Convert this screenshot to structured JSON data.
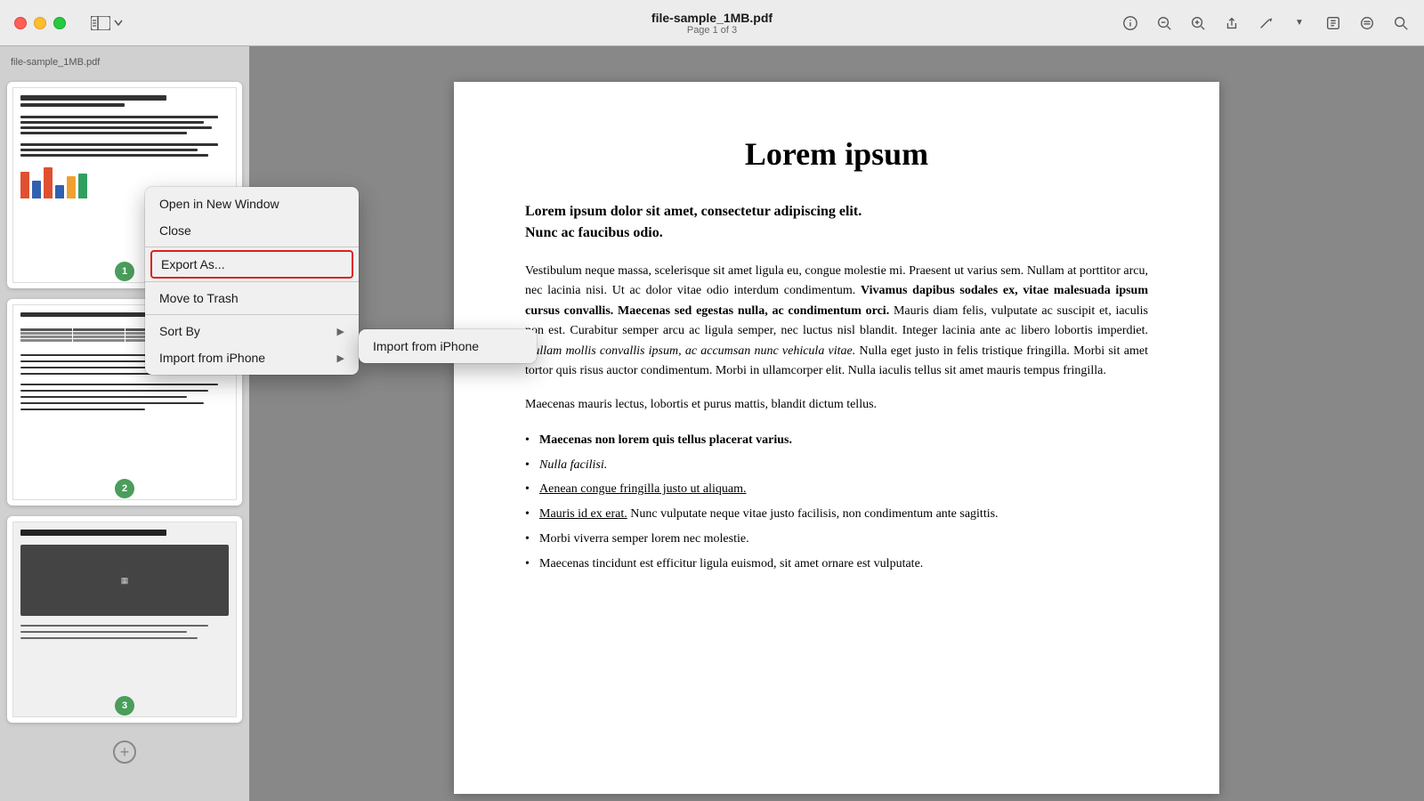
{
  "titlebar": {
    "file_name": "file-sample_1MB.pdf",
    "page_info": "Page 1 of 3"
  },
  "sidebar": {
    "label": "file-sample_1MB.pdf",
    "pages": [
      {
        "number": 1
      },
      {
        "number": 2
      },
      {
        "number": 3
      }
    ]
  },
  "context_menu": {
    "items": [
      {
        "id": "open_new_window",
        "label": "Open in New Window",
        "has_submenu": false
      },
      {
        "id": "close",
        "label": "Close",
        "has_submenu": false
      },
      {
        "id": "export_as",
        "label": "Export As...",
        "has_submenu": false,
        "highlighted": true
      },
      {
        "id": "move_to_trash",
        "label": "Move to Trash",
        "has_submenu": false
      },
      {
        "id": "sort_by",
        "label": "Sort By",
        "has_submenu": true
      },
      {
        "id": "import_from_iphone",
        "label": "Import from iPhone",
        "has_submenu": true
      }
    ]
  },
  "submenu": {
    "items": [
      {
        "id": "import_from_iphone_item",
        "label": "Import from iPhone"
      }
    ]
  },
  "pdf": {
    "title": "Lorem ipsum",
    "bold_intro": "Lorem ipsum dolor sit amet, consectetur adipiscing elit.\nNunc ac faucibus odio.",
    "body1": "Vestibulum neque massa, scelerisque sit amet ligula eu, congue molestie mi. Praesent ut varius sem. Nullam at porttitor arcu, nec lacinia nisi. Ut ac dolor vitae odio interdum condimentum. Vivamus dapibus sodales ex, vitae malesuada ipsum cursus convallis. Maecenas sed egestas nulla, ac condimentum orci. Mauris diam felis, vulputate ac suscipit et, iaculis non est. Curabitur semper arcu ac ligula semper, nec luctus nisl blandit. Integer lacinia ante ac libero lobortis imperdiet. Nullam mollis convallis ipsum, ac accumsan nunc vehicula vitae. Nulla eget justo in felis tristique fringilla. Morbi sit amet tortor quis risus auctor condimentum. Morbi in ullamcorper elit. Nulla iaculis tellus sit amet mauris tempus fringilla.",
    "body2": "Maecenas mauris lectus, lobortis et purus mattis, blandit dictum tellus.",
    "bullets": [
      {
        "text": "Maecenas non lorem quis tellus placerat varius.",
        "bold": true
      },
      {
        "text": "Nulla facilisi.",
        "italic": true
      },
      {
        "text": "Aenean congue fringilla justo ut aliquam.",
        "underline": true
      },
      {
        "text": "Mauris id ex erat. Nunc vulputate neque vitae justo facilisis, non condimentum ante sagittis.",
        "mixed": true
      },
      {
        "text": "Morbi viverra semper lorem nec molestie."
      },
      {
        "text": "Maecenas tincidunt est efficitur ligula euismod, sit amet ornare est vulputate."
      }
    ]
  },
  "colors": {
    "badge_green": "#4a9d5a",
    "highlight_red": "#e02020",
    "accent_blue": "#0066cc"
  }
}
